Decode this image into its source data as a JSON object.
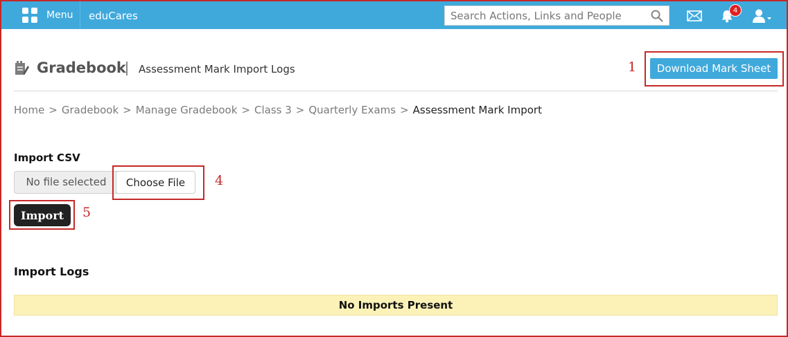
{
  "topbar": {
    "menu_label": "Menu",
    "app_name": "eduCares",
    "search_placeholder": "Search Actions, Links and People",
    "notification_count": "4",
    "bar_color": "#3fa9dc"
  },
  "header": {
    "title": "Gradebook",
    "subtitle": "Assessment Mark Import Logs",
    "download_label": "Download Mark Sheet"
  },
  "breadcrumb": {
    "items": [
      "Home",
      "Gradebook",
      "Manage Gradebook",
      "Class 3",
      "Quarterly Exams"
    ],
    "current": "Assessment Mark Import",
    "separator": ">"
  },
  "import_csv": {
    "label": "Import CSV",
    "file_status": "No file selected",
    "choose_label": "Choose File",
    "import_label": "Import"
  },
  "logs": {
    "label": "Import Logs",
    "empty_message": "No Imports Present"
  },
  "callouts": {
    "download": "1",
    "choose": "4",
    "import": "5",
    "color": "#c62828"
  },
  "icons": [
    "grid-menu-icon",
    "search-icon",
    "mail-icon",
    "bell-icon",
    "user-icon",
    "pencil-edit-icon"
  ]
}
